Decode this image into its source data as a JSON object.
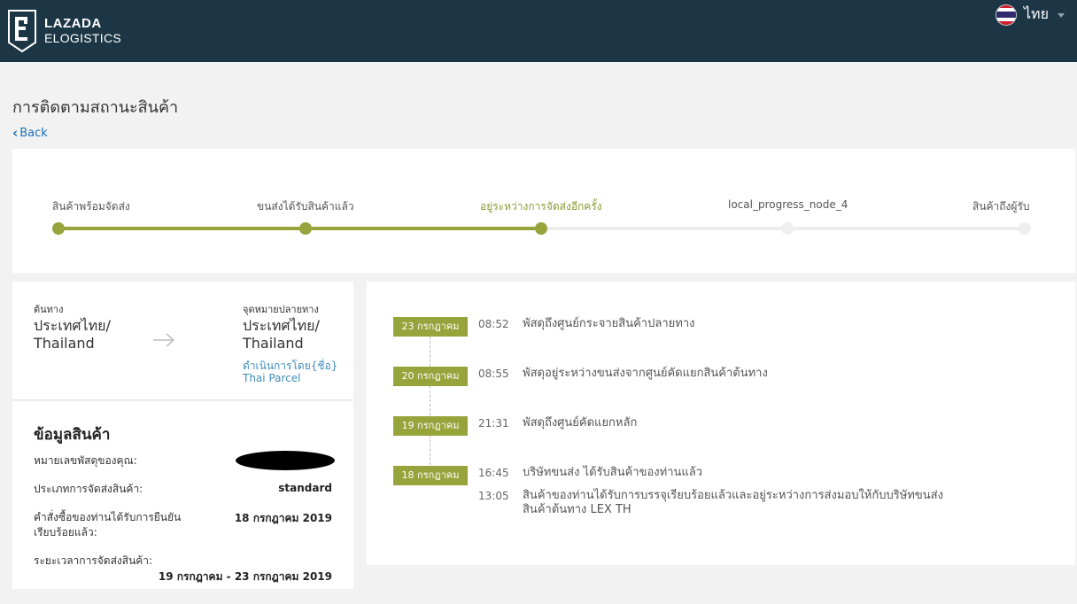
{
  "header": {
    "brand_line1": "LAZADA",
    "brand_line2": "ELOGISTICS",
    "language": "ไทย",
    "colors": {
      "bar": "#1c3646",
      "accent": "#97a33b",
      "link": "#1a6fb7"
    }
  },
  "page": {
    "title": "การติดตามสถานะสินค้า",
    "back_label": "Back"
  },
  "progress": {
    "steps": [
      {
        "label": "สินค้าพร้อมจัดส่ง",
        "done": true
      },
      {
        "label": "ขนส่งได้รับสินค้าแล้ว",
        "done": true
      },
      {
        "label": "อยู่ระหว่างการจัดส่งอีกครั้ง",
        "done": true,
        "current": true
      },
      {
        "label": "local_progress_node_4",
        "done": false
      },
      {
        "label": "สินค้าถึงผู้รับ",
        "done": false
      }
    ]
  },
  "route": {
    "origin_caption": "ต้นทาง",
    "origin_line1": "ประเทศไทย/",
    "origin_line2": "Thailand",
    "destination_caption": "จุดหมายปลายทาง",
    "destination_line1": "ประเทศไทย/",
    "destination_line2": "Thailand",
    "carrier_caption": "ดำเนินการโดย{ชื่อ}",
    "carrier_name": "Thai Parcel"
  },
  "product_info": {
    "title": "ข้อมูลสินค้า",
    "tracking_label": "หมายเลขพัสดุของคุณ:",
    "delivery_type_label": "ประเภทการจัดส่งสินค้า:",
    "delivery_type_value": "standard",
    "order_confirmed_label_1": "คำสั่งซื้อของท่านได้รับการยืนยัน",
    "order_confirmed_label_2": "เรียบร้อยแล้ว:",
    "order_confirmed_value": "18 กรกฎาคม 2019",
    "delivery_period_label": "ระยะเวลาการจัดส่งสินค้า:",
    "delivery_period_value": "19 กรกฎาคม - 23 กรกฎาคม 2019"
  },
  "timeline": [
    {
      "date": "23 กรกฎาคม",
      "events": [
        {
          "time": "08:52",
          "desc": "พัสดุถึงศูนย์กระจายสินค้าปลายทาง"
        }
      ]
    },
    {
      "date": "20 กรกฎาคม",
      "events": [
        {
          "time": "08:55",
          "desc": "พัสดุอยู่ระหว่างขนส่งจากศูนย์คัดแยกสินค้าต้นทาง"
        }
      ]
    },
    {
      "date": "19 กรกฎาคม",
      "events": [
        {
          "time": "21:31",
          "desc": "พัสดุถึงศูนย์คัดแยกหลัก"
        }
      ]
    },
    {
      "date": "18 กรกฎาคม",
      "events": [
        {
          "time": "16:45",
          "desc": "บริษัทขนส่ง ได้รับสินค้าของท่านแล้ว"
        },
        {
          "time": "13:05",
          "desc_line1": "สินค้าของท่านได้รับการบรรจุเรียบร้อยแล้วและอยู่ระหว่างการส่งมอบให้กับบริษัทขนส่ง",
          "desc_line2": "สินค้าต้นทาง LEX TH"
        }
      ]
    }
  ]
}
